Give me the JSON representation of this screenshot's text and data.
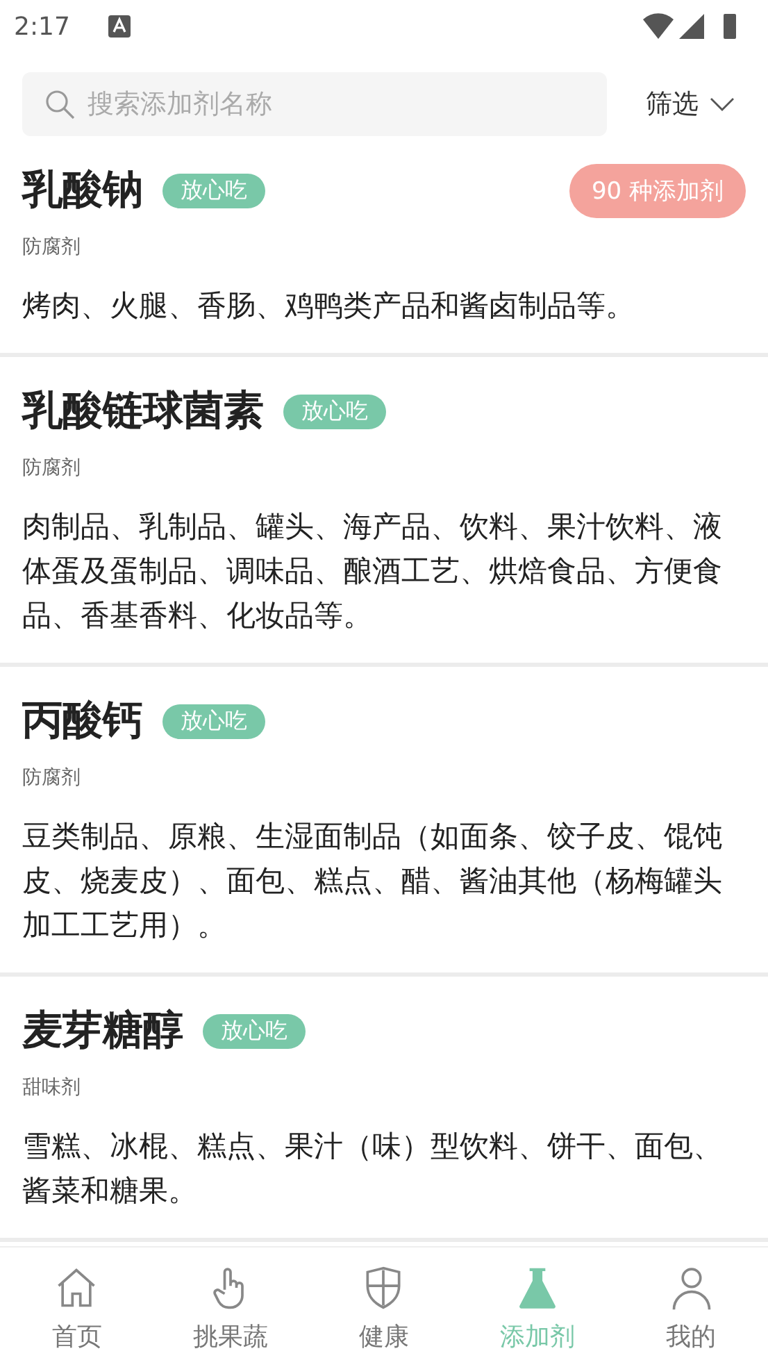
{
  "status_bar": {
    "time": "2:17"
  },
  "search": {
    "placeholder": "搜索添加剂名称"
  },
  "filter": {
    "label": "筛选"
  },
  "count_badge": "90 种添加剂",
  "additives": [
    {
      "name": "乳酸钠",
      "tag": "放心吃",
      "category": "防腐剂",
      "usage": "烤肉、火腿、香肠、鸡鸭类产品和酱卤制品等。"
    },
    {
      "name": "乳酸链球菌素",
      "tag": "放心吃",
      "category": "防腐剂",
      "usage": "肉制品、乳制品、罐头、海产品、饮料、果汁饮料、液体蛋及蛋制品、调味品、酿酒工艺、烘焙食品、方便食品、香基香料、化妆品等。"
    },
    {
      "name": "丙酸钙",
      "tag": "放心吃",
      "category": "防腐剂",
      "usage": "豆类制品、原粮、生湿面制品（如面条、饺子皮、馄饨皮、烧麦皮）、面包、糕点、醋、酱油其他（杨梅罐头加工工艺用）。"
    },
    {
      "name": "麦芽糖醇",
      "tag": "放心吃",
      "category": "甜味剂",
      "usage": "雪糕、冰棍、糕点、果汁（味）型饮料、饼干、面包、酱菜和糖果。"
    }
  ],
  "tab_bar": [
    {
      "kind": "home",
      "label": "首页",
      "selected": false
    },
    {
      "kind": "hand",
      "label": "挑果蔬",
      "selected": false
    },
    {
      "kind": "shield",
      "label": "健康",
      "selected": false
    },
    {
      "kind": "flask",
      "label": "添加剂",
      "selected": true
    },
    {
      "kind": "person",
      "label": "我的",
      "selected": false
    }
  ]
}
